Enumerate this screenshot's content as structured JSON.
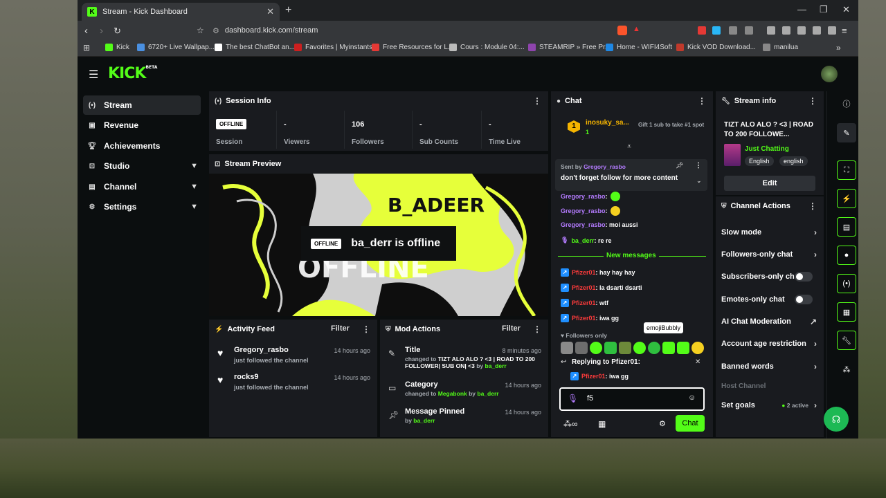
{
  "browser": {
    "tab_title": "Stream - Kick Dashboard",
    "url": "dashboard.kick.com/stream",
    "bookmarks": [
      "Kick",
      "6720+ Live Wallpap...",
      "The best ChatBot an...",
      "Favorites | Myinstants",
      "Free Resources for L...",
      "Cours : Module 04:...",
      "STEAMRIP » Free Pr...",
      "Home - WIFI4Soft",
      "Kick VOD Download...",
      "manilua"
    ],
    "bookmark_colors": [
      "#53fc18",
      "#4a90e2",
      "#ffffff",
      "#cc1f1f",
      "#e53935",
      "#bbbbbb",
      "#8e44ad",
      "#1e88e5",
      "#c0392b",
      "#888888"
    ]
  },
  "app": {
    "logo": "KICK",
    "beta": "BETA"
  },
  "sidebar": {
    "items": [
      {
        "label": "Stream",
        "icon": "stream-icon"
      },
      {
        "label": "Revenue",
        "icon": "revenue-icon"
      },
      {
        "label": "Achievements",
        "icon": "trophy-icon"
      },
      {
        "label": "Studio",
        "icon": "studio-icon"
      },
      {
        "label": "Channel",
        "icon": "channel-icon"
      },
      {
        "label": "Settings",
        "icon": "gear-icon"
      }
    ]
  },
  "session": {
    "title": "Session Info",
    "status": "OFFLINE",
    "status_label": "Session",
    "viewers": {
      "value": "-",
      "label": "Viewers"
    },
    "followers": {
      "value": "106",
      "label": "Followers"
    },
    "subs": {
      "value": "-",
      "label": "Sub Counts"
    },
    "time": {
      "value": "-",
      "label": "Time Live"
    }
  },
  "preview": {
    "title": "Stream Preview",
    "badge": "OFFLINE",
    "text": "ba_derr is offline",
    "bg_text": "B_ADEER",
    "bg_text2": "OFFLINE"
  },
  "activity": {
    "title": "Activity Feed",
    "filter": "Filter",
    "items": [
      {
        "name": "Gregory_rasbo",
        "sub": "just followed the channel",
        "time": "14 hours ago"
      },
      {
        "name": "rocks9",
        "sub": "just followed the channel",
        "time": "14 hours ago"
      }
    ]
  },
  "mod": {
    "title": "Mod Actions",
    "filter": "Filter",
    "items": [
      {
        "title": "Title",
        "time": "8 minutes ago",
        "pre": "changed to ",
        "value": "TIZT ALO ALO ? <3 | ROAD TO 200 FOLLOWER| SUB ON| <3",
        "by": " by ",
        "user": "ba_derr"
      },
      {
        "title": "Category",
        "time": "14 hours ago",
        "pre": "changed to ",
        "value": "Megabonk",
        "by": " by ",
        "user": "ba_derr"
      },
      {
        "title": "Message Pinned",
        "time": "14 hours ago",
        "pre": "",
        "value": "",
        "by": "by ",
        "user": "ba_derr"
      }
    ]
  },
  "chat": {
    "title": "Chat",
    "top_user": "inosuky_sa...",
    "top_rank": "1",
    "top_count": "1",
    "gift": "Gift 1 sub to take #1 spot",
    "pinned_by": "Sent by ",
    "pinned_user": "Gregory_rasbo",
    "pinned_msg": "don't forget follow for more content",
    "messages": [
      {
        "user": "Gregory_rasbo",
        "text": ""
      },
      {
        "user": "Gregory_rasbo",
        "text": ""
      },
      {
        "user": "Gregory_rasbo",
        "text": "moi aussi"
      },
      {
        "user": "ba_derr",
        "text": "re re"
      }
    ],
    "new_messages": "New messages",
    "new": [
      {
        "user": "Pfizer01",
        "text": "hay hay hay"
      },
      {
        "user": "Pfizer01",
        "text": "la dsarti dsarti"
      },
      {
        "user": "Pfizer01",
        "text": "wtf"
      },
      {
        "user": "Pfizer01",
        "text": "iwa gg"
      }
    ],
    "followers_only": "Followers only",
    "tooltip": "emojiBubbly",
    "replying": "Replying to Pfizer01:",
    "reply_user": "Pfizer01",
    "reply_text": "iwa gg",
    "input_value": "f5",
    "send": "Chat"
  },
  "stream_info": {
    "title": "Stream info",
    "stream_title": "TIZT ALO ALO ? <3 | ROAD TO 200 FOLLOWE...",
    "category": "Just Chatting",
    "tags": [
      "English",
      "english"
    ],
    "edit": "Edit"
  },
  "channel_actions": {
    "title": "Channel Actions",
    "items": [
      {
        "label": "Slow mode",
        "kind": "arrow"
      },
      {
        "label": "Followers-only chat",
        "kind": "arrow"
      },
      {
        "label": "Subscribers-only chat",
        "kind": "toggle"
      },
      {
        "label": "Emotes-only chat",
        "kind": "toggle"
      },
      {
        "label": "AI Chat Moderation",
        "kind": "link"
      },
      {
        "label": "Account age restriction",
        "kind": "arrow"
      },
      {
        "label": "Banned words",
        "kind": "arrow"
      }
    ],
    "host": "Host Channel",
    "goals": "Set goals",
    "goals_status": "2 active"
  },
  "colors": {
    "accent": "#53fc18",
    "panel": "#191b1f",
    "bg": "#0b0e0f",
    "red": "#ff3b3b",
    "purple": "#b47cff"
  }
}
